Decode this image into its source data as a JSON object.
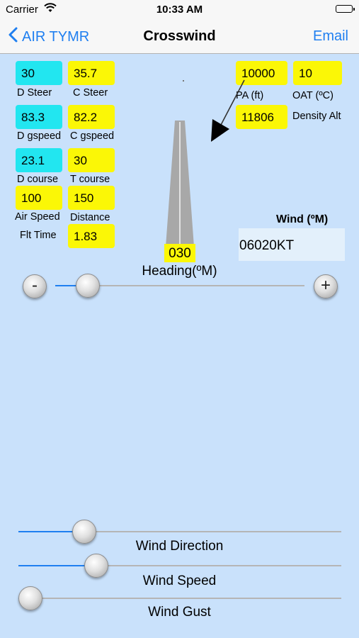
{
  "status": {
    "carrier": "Carrier",
    "time": "10:33 AM"
  },
  "nav": {
    "back_label": "AIR TYMR",
    "title": "Crosswind",
    "email_label": "Email"
  },
  "fields": {
    "d_steer": {
      "value": "30",
      "label": "D Steer"
    },
    "c_steer": {
      "value": "35.7",
      "label": "C Steer"
    },
    "d_gspeed": {
      "value": "83.3",
      "label": "D gspeed"
    },
    "c_gspeed": {
      "value": "82.2",
      "label": "C gspeed"
    },
    "d_course": {
      "value": "23.1",
      "label": "D course"
    },
    "t_course": {
      "value": "30",
      "label": "T course"
    },
    "air_speed": {
      "value": "100",
      "label": "Air Speed"
    },
    "distance": {
      "value": "150",
      "label": "Distance"
    },
    "flt_time": {
      "value": "1.83",
      "label": "Flt Time"
    },
    "pa": {
      "value": "10000",
      "label": "PA (ft)"
    },
    "oat": {
      "value": "10",
      "label": "OAT (ºC)"
    },
    "density_alt": {
      "value": "11806",
      "label": "Density Alt"
    }
  },
  "heading": {
    "value": "030",
    "label": "Heading(ºM)",
    "level": 0.09
  },
  "wind": {
    "title": "Wind (ºM)",
    "value": "06020KT"
  },
  "sliders": {
    "direction": {
      "label": "Wind Direction",
      "level": 0.18
    },
    "speed": {
      "label": "Wind Speed",
      "level": 0.22
    },
    "gust": {
      "label": "Wind Gust",
      "level": 0.0
    }
  },
  "colors": {
    "background": "#c9e1fb",
    "accent": "#1f7ff0",
    "computed": "#22e6f0",
    "input": "#fbf706"
  },
  "icons": {
    "back": "chevron-left-icon",
    "wifi": "wifi-icon",
    "battery": "battery-icon",
    "minus": "minus-icon",
    "plus": "plus-icon",
    "wind_arrow": "wind-arrow-icon"
  }
}
